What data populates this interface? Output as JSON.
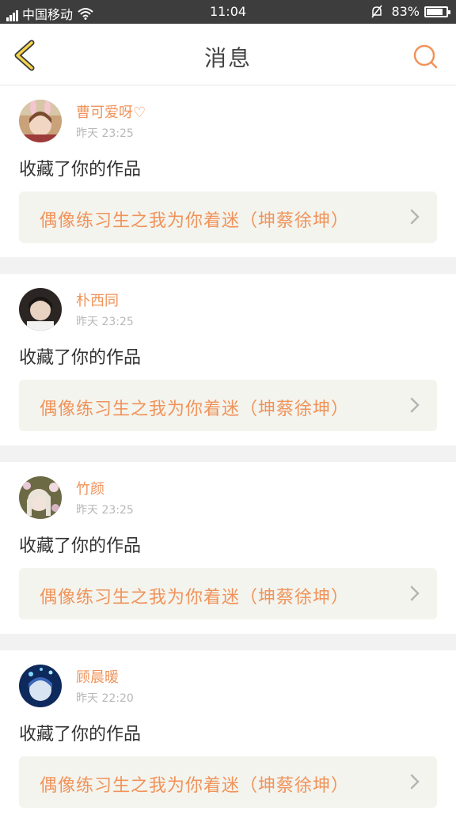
{
  "status_bar": {
    "carrier": "中国移动",
    "time": "11:04",
    "battery": "83%",
    "battery_level": 0.83
  },
  "header": {
    "title": "消息"
  },
  "accent_color": "#f0935a",
  "messages": [
    {
      "username": "曹可爱呀♡",
      "time": "昨天  23:25",
      "action": "收藏了你的作品",
      "work_title": "偶像练习生之我为你着迷（坤蔡徐坤）",
      "avatar_icon": "avatar-bunny-ears"
    },
    {
      "username": "朴西同",
      "time": "昨天  23:25",
      "action": "收藏了你的作品",
      "work_title": "偶像练习生之我为你着迷（坤蔡徐坤）",
      "avatar_icon": "avatar-dark-hair"
    },
    {
      "username": "竹颜",
      "time": "昨天  23:25",
      "action": "收藏了你的作品",
      "work_title": "偶像练习生之我为你着迷（坤蔡徐坤）",
      "avatar_icon": "avatar-flowers"
    },
    {
      "username": "顾晨暖",
      "time": "昨天  22:20",
      "action": "收藏了你的作品",
      "work_title": "偶像练习生之我为你着迷（坤蔡徐坤）",
      "avatar_icon": "avatar-blue-glow"
    }
  ]
}
